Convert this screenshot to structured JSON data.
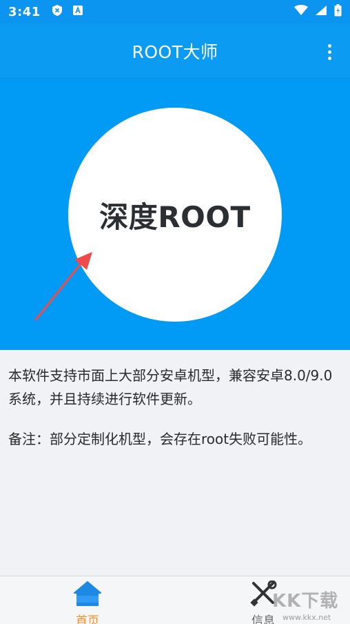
{
  "status_bar": {
    "time": "3:41"
  },
  "app_bar": {
    "title": "ROOT大师"
  },
  "hero": {
    "button_label": "深度ROOT"
  },
  "content": {
    "paragraph_1": "本软件支持市面上大部分安卓机型，兼容安卓8.0/9.0系统，并且持续进行软件更新。",
    "paragraph_2": "备注：部分定制化机型，会存在root失败可能性。"
  },
  "bottom_nav": {
    "items": [
      {
        "label": "首页",
        "active": true,
        "icon": "home-icon"
      },
      {
        "label": "信息",
        "active": false,
        "icon": "tools-icon"
      }
    ]
  },
  "watermark": {
    "text": "KK下载",
    "url": "www.kkx.net"
  },
  "colors": {
    "primary": "#0b9bf3",
    "hero_bg": "#019af4",
    "active_tab": "#ff8a1a",
    "arrow": "#f04b4b"
  }
}
